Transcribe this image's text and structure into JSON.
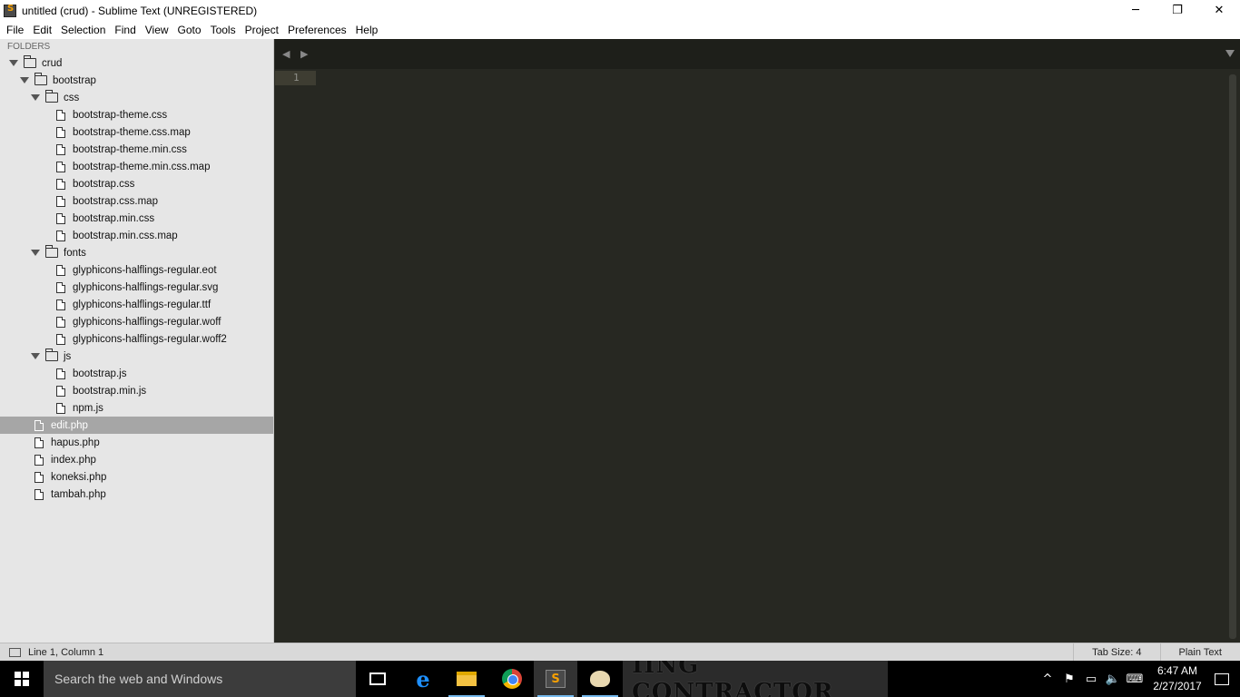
{
  "window": {
    "title": "untitled (crud) - Sublime Text (UNREGISTERED)",
    "minimize": "─",
    "restore": "❐",
    "close": "✕"
  },
  "menu": [
    "File",
    "Edit",
    "Selection",
    "Find",
    "View",
    "Goto",
    "Tools",
    "Project",
    "Preferences",
    "Help"
  ],
  "sidebar": {
    "header": "FOLDERS",
    "tree": [
      {
        "label": "crud",
        "kind": "folder",
        "depth": 0
      },
      {
        "label": "bootstrap",
        "kind": "folder",
        "depth": 1
      },
      {
        "label": "css",
        "kind": "folder",
        "depth": 2
      },
      {
        "label": "bootstrap-theme.css",
        "kind": "file",
        "depth": 3
      },
      {
        "label": "bootstrap-theme.css.map",
        "kind": "file",
        "depth": 3
      },
      {
        "label": "bootstrap-theme.min.css",
        "kind": "file",
        "depth": 3
      },
      {
        "label": "bootstrap-theme.min.css.map",
        "kind": "file",
        "depth": 3
      },
      {
        "label": "bootstrap.css",
        "kind": "file",
        "depth": 3
      },
      {
        "label": "bootstrap.css.map",
        "kind": "file",
        "depth": 3
      },
      {
        "label": "bootstrap.min.css",
        "kind": "file",
        "depth": 3
      },
      {
        "label": "bootstrap.min.css.map",
        "kind": "file",
        "depth": 3
      },
      {
        "label": "fonts",
        "kind": "folder",
        "depth": 2
      },
      {
        "label": "glyphicons-halflings-regular.eot",
        "kind": "file",
        "depth": 3
      },
      {
        "label": "glyphicons-halflings-regular.svg",
        "kind": "file",
        "depth": 3
      },
      {
        "label": "glyphicons-halflings-regular.ttf",
        "kind": "file",
        "depth": 3
      },
      {
        "label": "glyphicons-halflings-regular.woff",
        "kind": "file",
        "depth": 3
      },
      {
        "label": "glyphicons-halflings-regular.woff2",
        "kind": "file",
        "depth": 3
      },
      {
        "label": "js",
        "kind": "folder",
        "depth": 2
      },
      {
        "label": "bootstrap.js",
        "kind": "file",
        "depth": 3
      },
      {
        "label": "bootstrap.min.js",
        "kind": "file",
        "depth": 3
      },
      {
        "label": "npm.js",
        "kind": "file",
        "depth": 3
      },
      {
        "label": "edit.php",
        "kind": "file",
        "depth": 1,
        "selected": true
      },
      {
        "label": "hapus.php",
        "kind": "file",
        "depth": 1
      },
      {
        "label": "index.php",
        "kind": "file",
        "depth": 1
      },
      {
        "label": "koneksi.php",
        "kind": "file",
        "depth": 1
      },
      {
        "label": "tambah.php",
        "kind": "file",
        "depth": 1
      }
    ]
  },
  "editor": {
    "nav_arrows": "◀ ▶",
    "line_number": "1"
  },
  "status": {
    "position": "Line 1, Column 1",
    "tab_size": "Tab Size: 4",
    "syntax": "Plain Text"
  },
  "taskbar": {
    "search_placeholder": "Search the web and Windows",
    "preview_text": "IING CONTRACTOR",
    "time": "6:47 AM",
    "date": "2/27/2017"
  },
  "colors": {
    "editor_bg": "#272822",
    "sidebar_bg": "#e6e6e6",
    "selected_row": "#a6a6a6",
    "sublime_accent": "#f7a000"
  }
}
